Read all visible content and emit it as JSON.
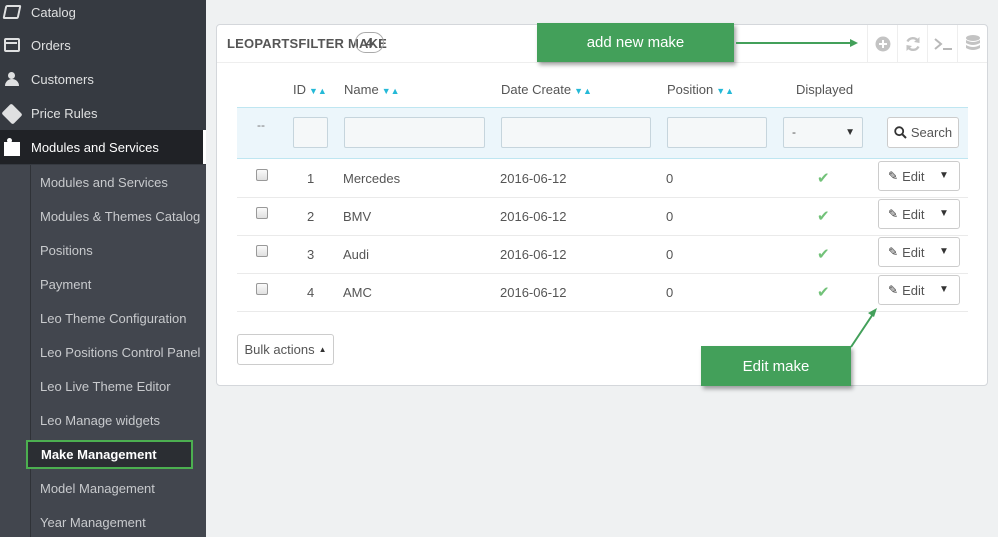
{
  "sidebar": {
    "items": [
      {
        "label": "Catalog",
        "icon": "book-icon"
      },
      {
        "label": "Orders",
        "icon": "credit-card-icon"
      },
      {
        "label": "Customers",
        "icon": "users-icon"
      },
      {
        "label": "Price Rules",
        "icon": "tags-icon"
      },
      {
        "label": "Modules and Services",
        "icon": "puzzle-icon",
        "active": true
      }
    ],
    "submenu": [
      "Modules and Services",
      "Modules & Themes Catalog",
      "Positions",
      "Payment",
      "Leo Theme Configuration",
      "Leo Positions Control Panel",
      "Leo Live Theme Editor",
      "Leo Manage widgets",
      "Make Management",
      "Model Management",
      "Year Management"
    ],
    "selected": "Make Management"
  },
  "panel": {
    "title": "LEOPARTSFILTER MAKE",
    "count": "4",
    "tools": [
      "add-icon",
      "refresh-icon",
      "terminal-icon",
      "database-icon"
    ]
  },
  "table": {
    "headers": {
      "id": "ID",
      "name": "Name",
      "date": "Date Create",
      "position": "Position",
      "displayed": "Displayed"
    },
    "filter": {
      "bulk_marker": "--",
      "select_value": "-",
      "search_label": "Search"
    },
    "rows": [
      {
        "id": "1",
        "name": "Mercedes",
        "date": "2016-06-12",
        "position": "0",
        "displayed": true
      },
      {
        "id": "2",
        "name": "BMV",
        "date": "2016-06-12",
        "position": "0",
        "displayed": true
      },
      {
        "id": "3",
        "name": "Audi",
        "date": "2016-06-12",
        "position": "0",
        "displayed": true
      },
      {
        "id": "4",
        "name": "AMC",
        "date": "2016-06-12",
        "position": "0",
        "displayed": true
      }
    ],
    "edit_label": "Edit",
    "bulk_actions_label": "Bulk actions"
  },
  "callouts": {
    "add": "add new make",
    "edit": "Edit make"
  },
  "colors": {
    "sidebar_bg": "#363a41",
    "accent": "#25b9d7",
    "callout_green": "#43a05a",
    "check_green": "#72c279"
  }
}
